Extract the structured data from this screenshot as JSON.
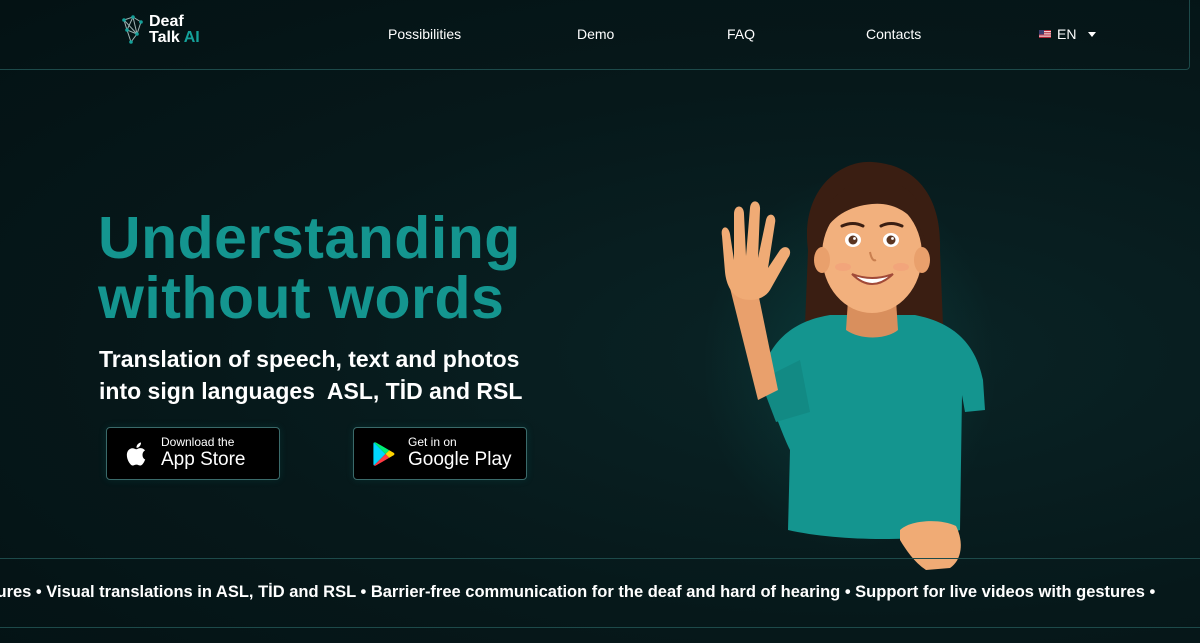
{
  "logo": {
    "line1": "Deaf",
    "line2_word": "Talk",
    "line2_ai": "AI"
  },
  "nav": {
    "items": [
      {
        "label": "Possibilities"
      },
      {
        "label": "Demo"
      },
      {
        "label": "FAQ"
      },
      {
        "label": "Contacts"
      }
    ],
    "language": "EN"
  },
  "hero": {
    "title_line1": "Understanding",
    "title_line2": "without words",
    "subtitle_line1": "Translation of speech, text and photos",
    "subtitle_line2": "into sign languages  ASL, TİD and RSL"
  },
  "stores": {
    "apple": {
      "small": "Download the",
      "big": "App Store"
    },
    "google": {
      "small": "Get in on",
      "big": "Google Play"
    }
  },
  "ticker": {
    "text": "tures • Visual translations in ASL, TİD and RSL • Barrier-free communication for the deaf and hard of hearing • Support for live videos with gestures •"
  },
  "colors": {
    "accent": "#14958f",
    "background": "#06181a",
    "border": "#1d4a4a",
    "shirt": "#14958f"
  },
  "icons": {
    "logo": "network-hand-icon",
    "apple": "apple-icon",
    "google_play": "google-play-icon",
    "flag": "us-flag-icon",
    "caret": "chevron-down-icon"
  }
}
